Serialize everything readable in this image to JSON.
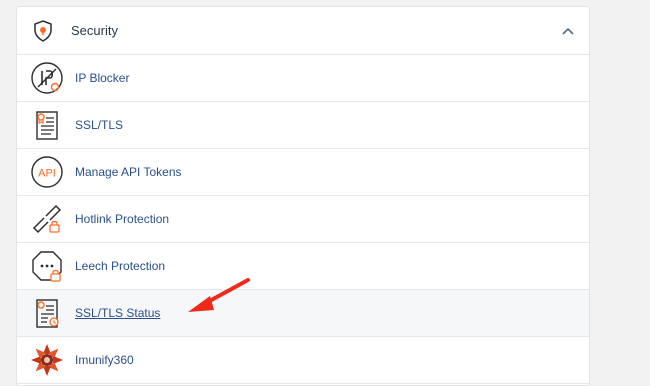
{
  "section": {
    "title": "Security",
    "icon": "shield-icon",
    "collapse_icon": "chevron-up-icon"
  },
  "items": [
    {
      "label": "IP Blocker",
      "icon": "ip-blocker-icon"
    },
    {
      "label": "SSL/TLS",
      "icon": "certificate-icon"
    },
    {
      "label": "Manage API Tokens",
      "icon": "api-icon"
    },
    {
      "label": "Hotlink Protection",
      "icon": "hotlink-icon"
    },
    {
      "label": "Leech Protection",
      "icon": "leech-icon"
    },
    {
      "label": "SSL/TLS Status",
      "icon": "certificate-status-icon"
    },
    {
      "label": "Imunify360",
      "icon": "imunify-icon"
    }
  ],
  "colors": {
    "link": "#2b4f8a",
    "accent": "#ff6c2c",
    "arrow": "#ee2a1a",
    "icon_stroke": "#2d2d2d"
  }
}
